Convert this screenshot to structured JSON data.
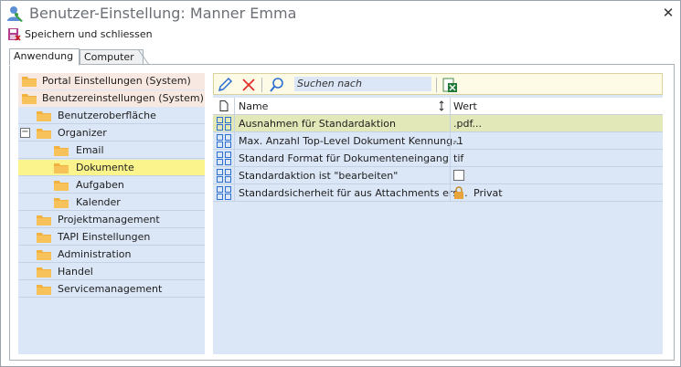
{
  "window": {
    "title": "Benutzer-Einstellung: Manner Emma",
    "close_glyph": "✕"
  },
  "toolbar": {
    "save_label": "Speichern und schliessen"
  },
  "tabs": [
    {
      "label": "Anwendung",
      "active": true
    },
    {
      "label": "Computer",
      "active": false
    }
  ],
  "tree": {
    "items": [
      {
        "label": "Portal Einstellungen (System)"
      },
      {
        "label": "Benutzereinstellungen (System)"
      },
      {
        "label": "Benutzeroberfläche"
      },
      {
        "label": "Organizer",
        "expander": "−"
      },
      {
        "label": "Email"
      },
      {
        "label": "Dokumente",
        "selected": true
      },
      {
        "label": "Aufgaben"
      },
      {
        "label": "Kalender"
      },
      {
        "label": "Projektmanagement"
      },
      {
        "label": "TAPI Einstellungen"
      },
      {
        "label": "Administration"
      },
      {
        "label": "Handel"
      },
      {
        "label": "Servicemanagement"
      }
    ]
  },
  "right_toolbar": {
    "search_placeholder": "Suchen nach"
  },
  "grid": {
    "columns": {
      "name": "Name",
      "value": "Wert"
    },
    "rows": [
      {
        "name": "Ausnahmen für Standardaktion",
        "value": ".pdf..."
      },
      {
        "name": "Max. Anzahl Top-Level Dokument Kennung...",
        "value": "-1"
      },
      {
        "name": "Standard Format für Dokumenteneingang",
        "value": "tif"
      },
      {
        "name": "Standardaktion ist \"bearbeiten\"",
        "value": "",
        "checked": false
      },
      {
        "name": "Standardsicherheit für aus Attachments ers...",
        "value": "Privat"
      }
    ]
  },
  "colors": {
    "accent": "#fbf48d",
    "panel": "#dbe6f6",
    "icon_blue": "#2c6fd1",
    "delete_red": "#e0302a"
  }
}
